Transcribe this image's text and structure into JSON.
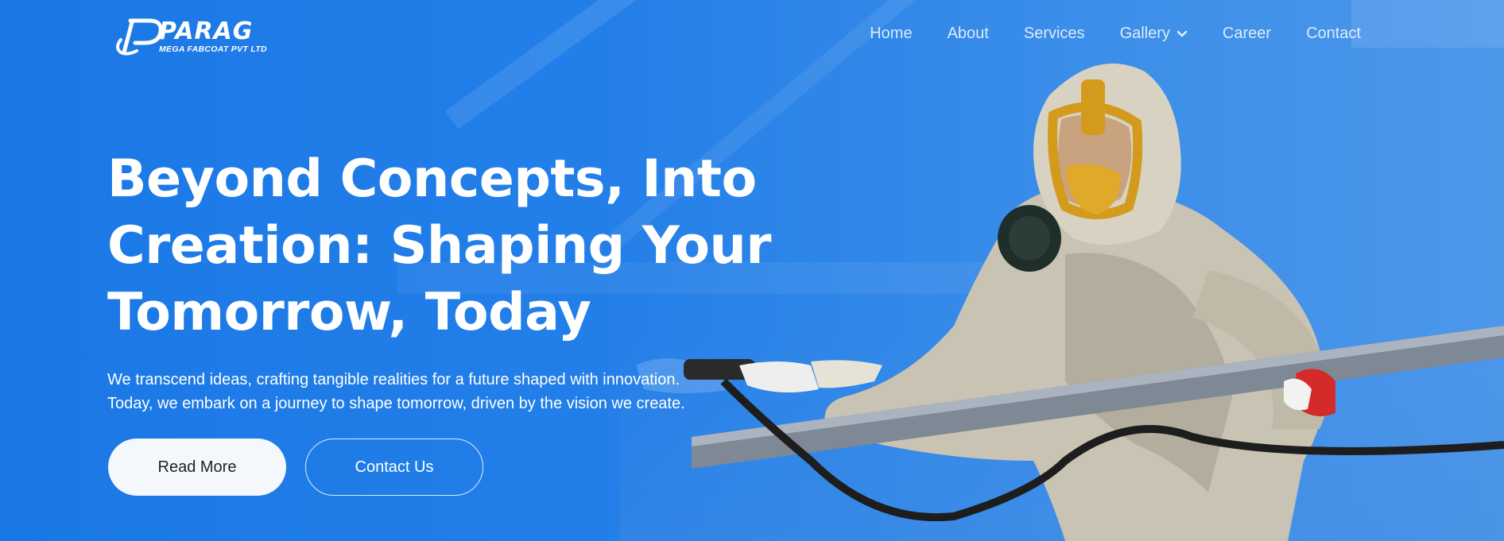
{
  "brand": {
    "name": "PARAG",
    "subtitle": "MEGA FABCOAT PVT LTD",
    "logo_icon": "parag-logo-icon"
  },
  "nav": {
    "items": [
      {
        "label": "Home"
      },
      {
        "label": "About"
      },
      {
        "label": "Services"
      },
      {
        "label": "Gallery",
        "has_dropdown": true
      },
      {
        "label": "Career"
      },
      {
        "label": "Contact"
      }
    ]
  },
  "hero": {
    "headline_lines": [
      "Beyond Concepts, Into",
      "Creation: Shaping Your",
      "Tomorrow, Today"
    ],
    "subtext_lines": [
      "We transcend ideas, crafting tangible realities for a future shaped with innovation.",
      "Today, we embark on a journey to shape tomorrow, driven by the vision we create."
    ],
    "primary_button": "Read More",
    "secondary_button": "Contact Us",
    "image": "worker-spray-painting-image"
  },
  "colors": {
    "background": "#1f7ce6",
    "primary_button_bg": "#f4f7fc",
    "text": "#ffffff"
  }
}
